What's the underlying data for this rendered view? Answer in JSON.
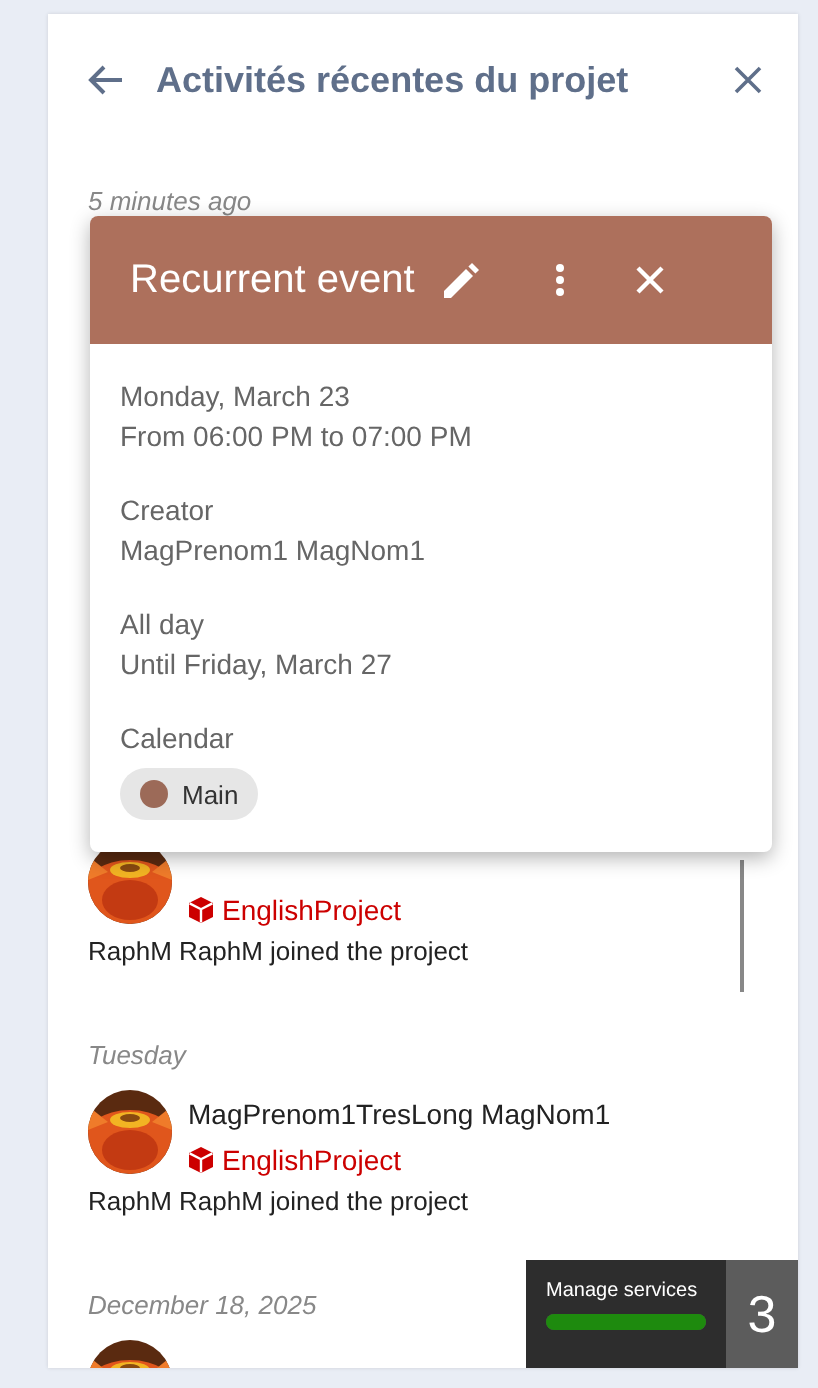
{
  "panel": {
    "title": "Activités récentes du projet"
  },
  "groups": [
    {
      "date": "5 minutes ago",
      "items": [
        {
          "project": "EnglishProject",
          "text": "RaphM RaphM joined the project"
        }
      ]
    },
    {
      "date": "Tuesday",
      "items": [
        {
          "name": "MagPrenom1TresLong MagNom1",
          "project": "EnglishProject",
          "text": "RaphM RaphM joined the project"
        }
      ]
    },
    {
      "date": "December 18, 2025"
    }
  ],
  "popup": {
    "title": "Recurrent event",
    "sections": [
      {
        "lines": [
          "Monday, March 23",
          "From 06:00 PM to 07:00 PM"
        ]
      },
      {
        "lines": [
          "Creator",
          "MagPrenom1 MagNom1"
        ]
      },
      {
        "lines": [
          "All day",
          "Until Friday, March 27"
        ]
      },
      {
        "lines": [
          "Calendar"
        ],
        "calendar": {
          "name": "Main",
          "color": "#9c6a58"
        }
      }
    ]
  },
  "services": {
    "label": "Manage services",
    "level": 1.0,
    "count": "3"
  }
}
